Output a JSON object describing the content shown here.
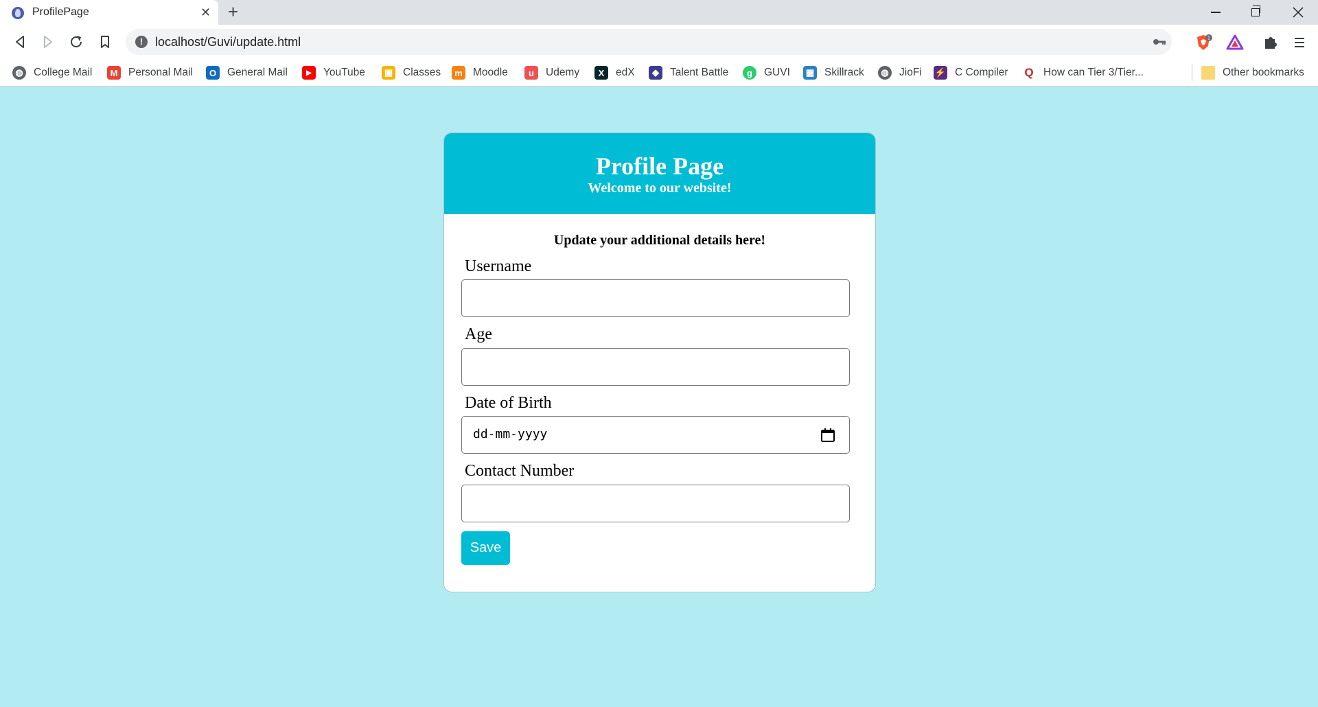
{
  "browser": {
    "tab_title": "ProfilePage",
    "url": "localhost/Guvi/update.html",
    "new_tab_glyph": "+",
    "close_tab_glyph": "✕",
    "brave_badge_count": "1",
    "bookmarks": [
      {
        "label": "College Mail",
        "icon": "globe-icon",
        "color": "#5f6368",
        "glyph": "◍"
      },
      {
        "label": "Personal Mail",
        "icon": "gmail-icon",
        "color": "#ea4335",
        "glyph": "M"
      },
      {
        "label": "General Mail",
        "icon": "outlook-icon",
        "color": "#0f6cbd",
        "glyph": "O"
      },
      {
        "label": "YouTube",
        "icon": "youtube-icon",
        "color": "#ff0000",
        "glyph": "▶"
      },
      {
        "label": "Classes",
        "icon": "classroom-icon",
        "color": "#f4b400",
        "glyph": "▣"
      },
      {
        "label": "Moodle",
        "icon": "moodle-icon",
        "color": "#f98012",
        "glyph": "m"
      },
      {
        "label": "Udemy",
        "icon": "udemy-icon",
        "color": "#ec5252",
        "glyph": "u"
      },
      {
        "label": "edX",
        "icon": "edx-icon",
        "color": "#02262b",
        "glyph": "X"
      },
      {
        "label": "Talent Battle",
        "icon": "talent-battle-icon",
        "color": "#3d3b8e",
        "glyph": "◆"
      },
      {
        "label": "GUVI",
        "icon": "guvi-icon",
        "color": "#2ecc71",
        "glyph": "g"
      },
      {
        "label": "Skillrack",
        "icon": "skillrack-icon",
        "color": "#2f80c2",
        "glyph": "▦"
      },
      {
        "label": "JioFi",
        "icon": "globe-icon",
        "color": "#5f6368",
        "glyph": "◍"
      },
      {
        "label": "C Compiler",
        "icon": "c-compiler-icon",
        "color": "#5b2a86",
        "glyph": "⚡"
      },
      {
        "label": "How can Tier 3/Tier...",
        "icon": "quora-icon",
        "color": "#b92b27",
        "glyph": "Q"
      }
    ],
    "other_bookmarks": "Other bookmarks"
  },
  "page": {
    "title": "Profile Page",
    "subtitle": "Welcome to our website!",
    "intro": "Update your additional details here!",
    "fields": {
      "username": {
        "label": "Username",
        "value": ""
      },
      "age": {
        "label": "Age",
        "value": ""
      },
      "dob": {
        "label": "Date of Birth",
        "placeholder": "dd-mm-yyyy"
      },
      "contact": {
        "label": "Contact Number",
        "value": ""
      }
    },
    "save_label": "Save"
  },
  "colors": {
    "page_background": "#b2ebf2",
    "header_accent": "#00bcd4",
    "button": "#00bcd4"
  }
}
